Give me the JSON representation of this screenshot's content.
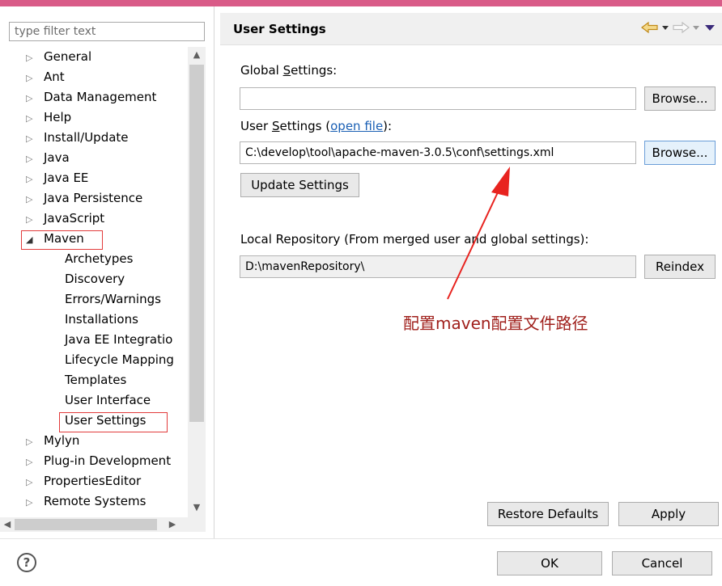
{
  "window": {
    "accent_color": "#d95b88"
  },
  "filter": {
    "placeholder": "type filter text"
  },
  "tree": {
    "items": [
      {
        "label": "General",
        "expander": "collapsed"
      },
      {
        "label": "Ant",
        "expander": "collapsed"
      },
      {
        "label": "Data Management",
        "expander": "collapsed"
      },
      {
        "label": "Help",
        "expander": "collapsed"
      },
      {
        "label": "Install/Update",
        "expander": "collapsed"
      },
      {
        "label": "Java",
        "expander": "collapsed"
      },
      {
        "label": "Java EE",
        "expander": "collapsed"
      },
      {
        "label": "Java Persistence",
        "expander": "collapsed"
      },
      {
        "label": "JavaScript",
        "expander": "collapsed"
      },
      {
        "label": "Maven",
        "expander": "expanded"
      },
      {
        "label": "Archetypes",
        "expander": "none"
      },
      {
        "label": "Discovery",
        "expander": "none"
      },
      {
        "label": "Errors/Warnings",
        "expander": "none"
      },
      {
        "label": "Installations",
        "expander": "none"
      },
      {
        "label": "Java EE Integratio",
        "expander": "none"
      },
      {
        "label": "Lifecycle Mapping",
        "expander": "none"
      },
      {
        "label": "Templates",
        "expander": "none"
      },
      {
        "label": "User Interface",
        "expander": "none"
      },
      {
        "label": "User Settings",
        "expander": "none",
        "selected": true
      },
      {
        "label": "Mylyn",
        "expander": "collapsed"
      },
      {
        "label": "Plug-in Development",
        "expander": "collapsed"
      },
      {
        "label": "PropertiesEditor",
        "expander": "collapsed"
      },
      {
        "label": "Remote Systems",
        "expander": "collapsed"
      }
    ]
  },
  "panel": {
    "title": "User Settings",
    "nav_icons": [
      "back-arrow-icon",
      "back-dropdown-icon",
      "forward-arrow-icon",
      "forward-dropdown-icon",
      "view-menu-icon"
    ]
  },
  "global_settings": {
    "label_prefix": "Global ",
    "label_mnemonic": "S",
    "label_suffix": "ettings:",
    "value": "",
    "browse_label": "Browse..."
  },
  "user_settings": {
    "label_prefix": "User ",
    "label_mnemonic": "S",
    "label_suffix": "ettings (",
    "link_text": "open file",
    "label_end": "):",
    "value": "C:\\develop\\tool\\apache-maven-3.0.5\\conf\\settings.xml",
    "browse_label": "Browse...",
    "update_label": "Update Settings"
  },
  "local_repo": {
    "label": "Local Repository (From merged user and global settings):",
    "value": "D:\\mavenRepository\\",
    "reindex_label": "Reindex"
  },
  "annotation": {
    "text": "配置maven配置文件路径",
    "color": "#a0201c"
  },
  "footer": {
    "restore_label": "Restore Defaults",
    "apply_label": "Apply",
    "ok_label": "OK",
    "cancel_label": "Cancel",
    "help_glyph": "?"
  }
}
